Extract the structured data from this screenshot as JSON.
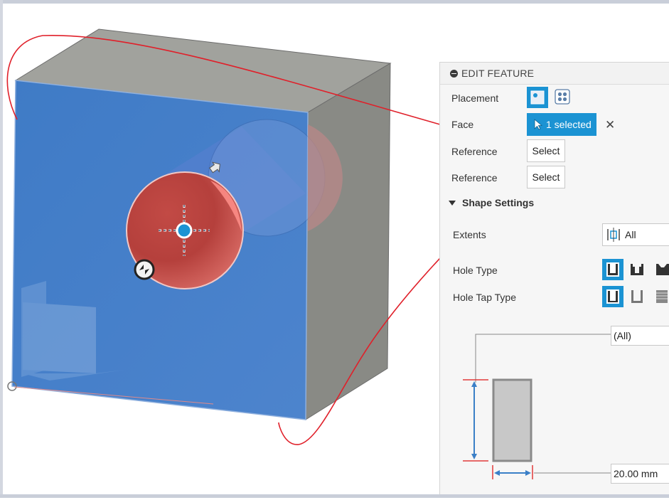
{
  "panel": {
    "title": "EDIT FEATURE",
    "placement": {
      "label": "Placement",
      "options": [
        "single-hole-icon",
        "multiple-holes-icon"
      ],
      "selected": "single-hole-icon"
    },
    "face": {
      "label": "Face",
      "button": "1 selected"
    },
    "reference1": {
      "label": "Reference",
      "button": "Select"
    },
    "reference2": {
      "label": "Reference",
      "button": "Select"
    },
    "shape_settings": {
      "title": "Shape Settings",
      "extents": {
        "label": "Extents",
        "value": "All"
      },
      "hole_type": {
        "label": "Hole Type",
        "options": [
          "simple-hole-icon",
          "counterbore-icon",
          "countersink-icon"
        ],
        "selected": "simple-hole-icon"
      },
      "hole_tap_type": {
        "label": "Hole Tap Type",
        "options": [
          "simple-tap-icon",
          "clearance-icon",
          "tapped-icon"
        ],
        "selected": "simple-tap-icon"
      },
      "depth_field": "(All)",
      "diameter_field": "20.00 mm"
    }
  },
  "colors": {
    "accent": "#1b93d3",
    "face_blue": "#4a7fc7",
    "hole_red": "#c9423d",
    "annotation_red": "#e0202a"
  }
}
